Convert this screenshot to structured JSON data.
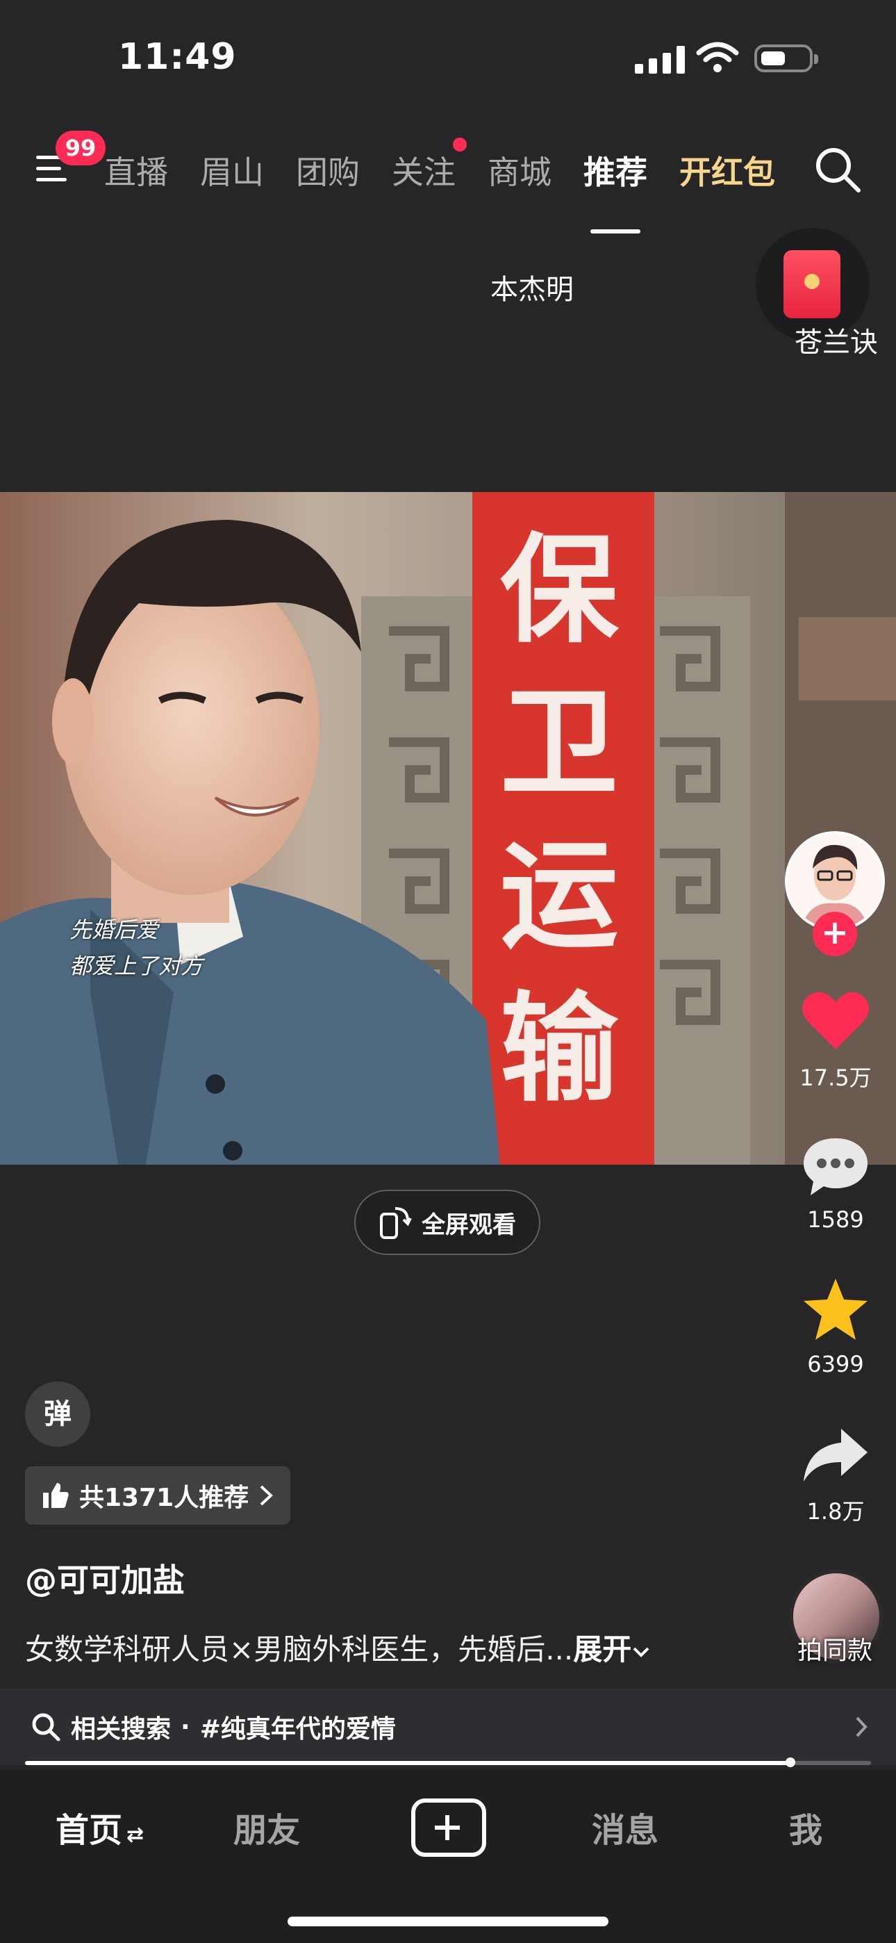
{
  "status_bar": {
    "time": "11:49"
  },
  "top_nav": {
    "badge_count": "99",
    "tabs": [
      {
        "label": "直播"
      },
      {
        "label": "眉山"
      },
      {
        "label": "团购"
      },
      {
        "label": "关注"
      },
      {
        "label": "商城"
      },
      {
        "label": "推荐"
      },
      {
        "label": "开红包"
      }
    ],
    "active_tab": "推荐"
  },
  "overlay": {
    "suggested_search": "本杰明",
    "red_packet_label": "苍兰诀"
  },
  "video": {
    "banner_text": "保卫运输",
    "caption_lines": [
      "先婚后爱",
      "都爱上了对方"
    ]
  },
  "fullscreen_button": {
    "label": "全屏观看"
  },
  "right_rail": {
    "likes": "17.5万",
    "comments": "1589",
    "favorites": "6399",
    "shares": "1.8万",
    "music_label": "拍同款"
  },
  "bottom_info": {
    "danmu_label": "弹",
    "recommend_text": "共1371人推荐",
    "author": "@可可加盐",
    "description": "女数学科研人员×男脑外科医生，先婚后...",
    "expand_label": "展开",
    "related_search_label": "相关搜索",
    "related_search_separator": "·",
    "related_search_topic": "#纯真年代的爱情",
    "progress_fraction": 0.905
  },
  "tab_bar": {
    "home": "首页",
    "friends": "朋友",
    "messages": "消息",
    "me": "我"
  },
  "colors": {
    "accent_red": "#fe2c55",
    "gold_tab": "#f7d58a",
    "favorite_yellow": "#fcc11a",
    "background": "#262528"
  }
}
